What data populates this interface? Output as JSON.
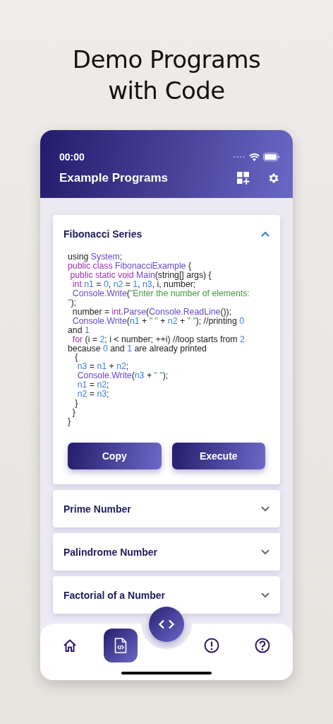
{
  "headline": [
    "Demo Programs",
    "with Code"
  ],
  "status_bar": {
    "time": "00:00"
  },
  "app_bar": {
    "title": "Example Programs"
  },
  "cards": [
    {
      "title": "Fibonacci Series",
      "expanded": true,
      "code": [
        [
          {
            "kind": "plain",
            "text": "using "
          },
          {
            "kind": "type",
            "text": "System"
          },
          {
            "kind": "plain",
            "text": ";"
          }
        ],
        [
          {
            "kind": "keyword",
            "text": "public class "
          },
          {
            "kind": "type",
            "text": "FibonacciExample"
          },
          {
            "kind": "plain",
            "text": " {"
          }
        ],
        [
          {
            "kind": "keyword",
            "text": " public static void "
          },
          {
            "kind": "type",
            "text": "Main"
          },
          {
            "kind": "plain",
            "text": "(string[] args) {"
          }
        ],
        [
          {
            "kind": "keyword",
            "text": "  int "
          },
          {
            "kind": "number",
            "text": "n1"
          },
          {
            "kind": "plain",
            "text": " = "
          },
          {
            "kind": "number",
            "text": "0"
          },
          {
            "kind": "plain",
            "text": ", "
          },
          {
            "kind": "number",
            "text": "n2"
          },
          {
            "kind": "plain",
            "text": " = "
          },
          {
            "kind": "number",
            "text": "1"
          },
          {
            "kind": "plain",
            "text": ", "
          },
          {
            "kind": "number",
            "text": "n3"
          },
          {
            "kind": "plain",
            "text": ", i, number;"
          }
        ],
        [
          {
            "kind": "type",
            "text": "  Console.Write"
          },
          {
            "kind": "plain",
            "text": "("
          },
          {
            "kind": "string",
            "text": "\"Enter the number of elements:"
          }
        ],
        [
          {
            "kind": "string",
            "text": "\""
          },
          {
            "kind": "plain",
            "text": ");"
          }
        ],
        [
          {
            "kind": "plain",
            "text": "  number = "
          },
          {
            "kind": "keyword",
            "text": "int"
          },
          {
            "kind": "plain",
            "text": "."
          },
          {
            "kind": "type",
            "text": "Parse"
          },
          {
            "kind": "plain",
            "text": "("
          },
          {
            "kind": "type",
            "text": "Console.ReadLine"
          },
          {
            "kind": "plain",
            "text": "());"
          }
        ],
        [
          {
            "kind": "type",
            "text": "  Console.Write"
          },
          {
            "kind": "plain",
            "text": "("
          },
          {
            "kind": "number",
            "text": "n1"
          },
          {
            "kind": "plain",
            "text": " + "
          },
          {
            "kind": "string",
            "text": "\" \""
          },
          {
            "kind": "plain",
            "text": " + "
          },
          {
            "kind": "number",
            "text": "n2"
          },
          {
            "kind": "plain",
            "text": " + "
          },
          {
            "kind": "string",
            "text": "\" \""
          },
          {
            "kind": "plain",
            "text": "); //printing "
          },
          {
            "kind": "number",
            "text": "0"
          }
        ],
        [
          {
            "kind": "plain",
            "text": "and "
          },
          {
            "kind": "number",
            "text": "1"
          }
        ],
        [
          {
            "kind": "keyword",
            "text": "  for"
          },
          {
            "kind": "plain",
            "text": " (i = "
          },
          {
            "kind": "number",
            "text": "2"
          },
          {
            "kind": "plain",
            "text": "; i < number; ++i) //loop starts from "
          },
          {
            "kind": "number",
            "text": "2"
          }
        ],
        [
          {
            "kind": "plain",
            "text": "because "
          },
          {
            "kind": "number",
            "text": "0"
          },
          {
            "kind": "plain",
            "text": " and "
          },
          {
            "kind": "number",
            "text": "1"
          },
          {
            "kind": "plain",
            "text": " are already printed"
          }
        ],
        [
          {
            "kind": "plain",
            "text": "   {"
          }
        ],
        [
          {
            "kind": "number",
            "text": "    n3"
          },
          {
            "kind": "plain",
            "text": " = "
          },
          {
            "kind": "number",
            "text": "n1"
          },
          {
            "kind": "plain",
            "text": " + "
          },
          {
            "kind": "number",
            "text": "n2"
          },
          {
            "kind": "plain",
            "text": ";"
          }
        ],
        [
          {
            "kind": "type",
            "text": "    Console.Write"
          },
          {
            "kind": "plain",
            "text": "("
          },
          {
            "kind": "number",
            "text": "n3"
          },
          {
            "kind": "plain",
            "text": " + "
          },
          {
            "kind": "string",
            "text": "\" \""
          },
          {
            "kind": "plain",
            "text": ");"
          }
        ],
        [
          {
            "kind": "number",
            "text": "    n1"
          },
          {
            "kind": "plain",
            "text": " = "
          },
          {
            "kind": "number",
            "text": "n2"
          },
          {
            "kind": "plain",
            "text": ";"
          }
        ],
        [
          {
            "kind": "number",
            "text": "    n2"
          },
          {
            "kind": "plain",
            "text": " = "
          },
          {
            "kind": "number",
            "text": "n3"
          },
          {
            "kind": "plain",
            "text": ";"
          }
        ],
        [
          {
            "kind": "plain",
            "text": "   }"
          }
        ],
        [
          {
            "kind": "plain",
            "text": "  }"
          }
        ],
        [
          {
            "kind": "plain",
            "text": "}"
          }
        ]
      ],
      "buttons": [
        "Copy",
        "Execute"
      ]
    },
    {
      "title": "Prime Number",
      "expanded": false
    },
    {
      "title": "Palindrome Number",
      "expanded": false
    },
    {
      "title": "Factorial of a Number",
      "expanded": false
    }
  ],
  "nav": [
    {
      "kind": "home",
      "selected": false
    },
    {
      "kind": "code-file",
      "selected": true
    },
    {
      "kind": "alert",
      "selected": false
    },
    {
      "kind": "help",
      "selected": false
    }
  ]
}
